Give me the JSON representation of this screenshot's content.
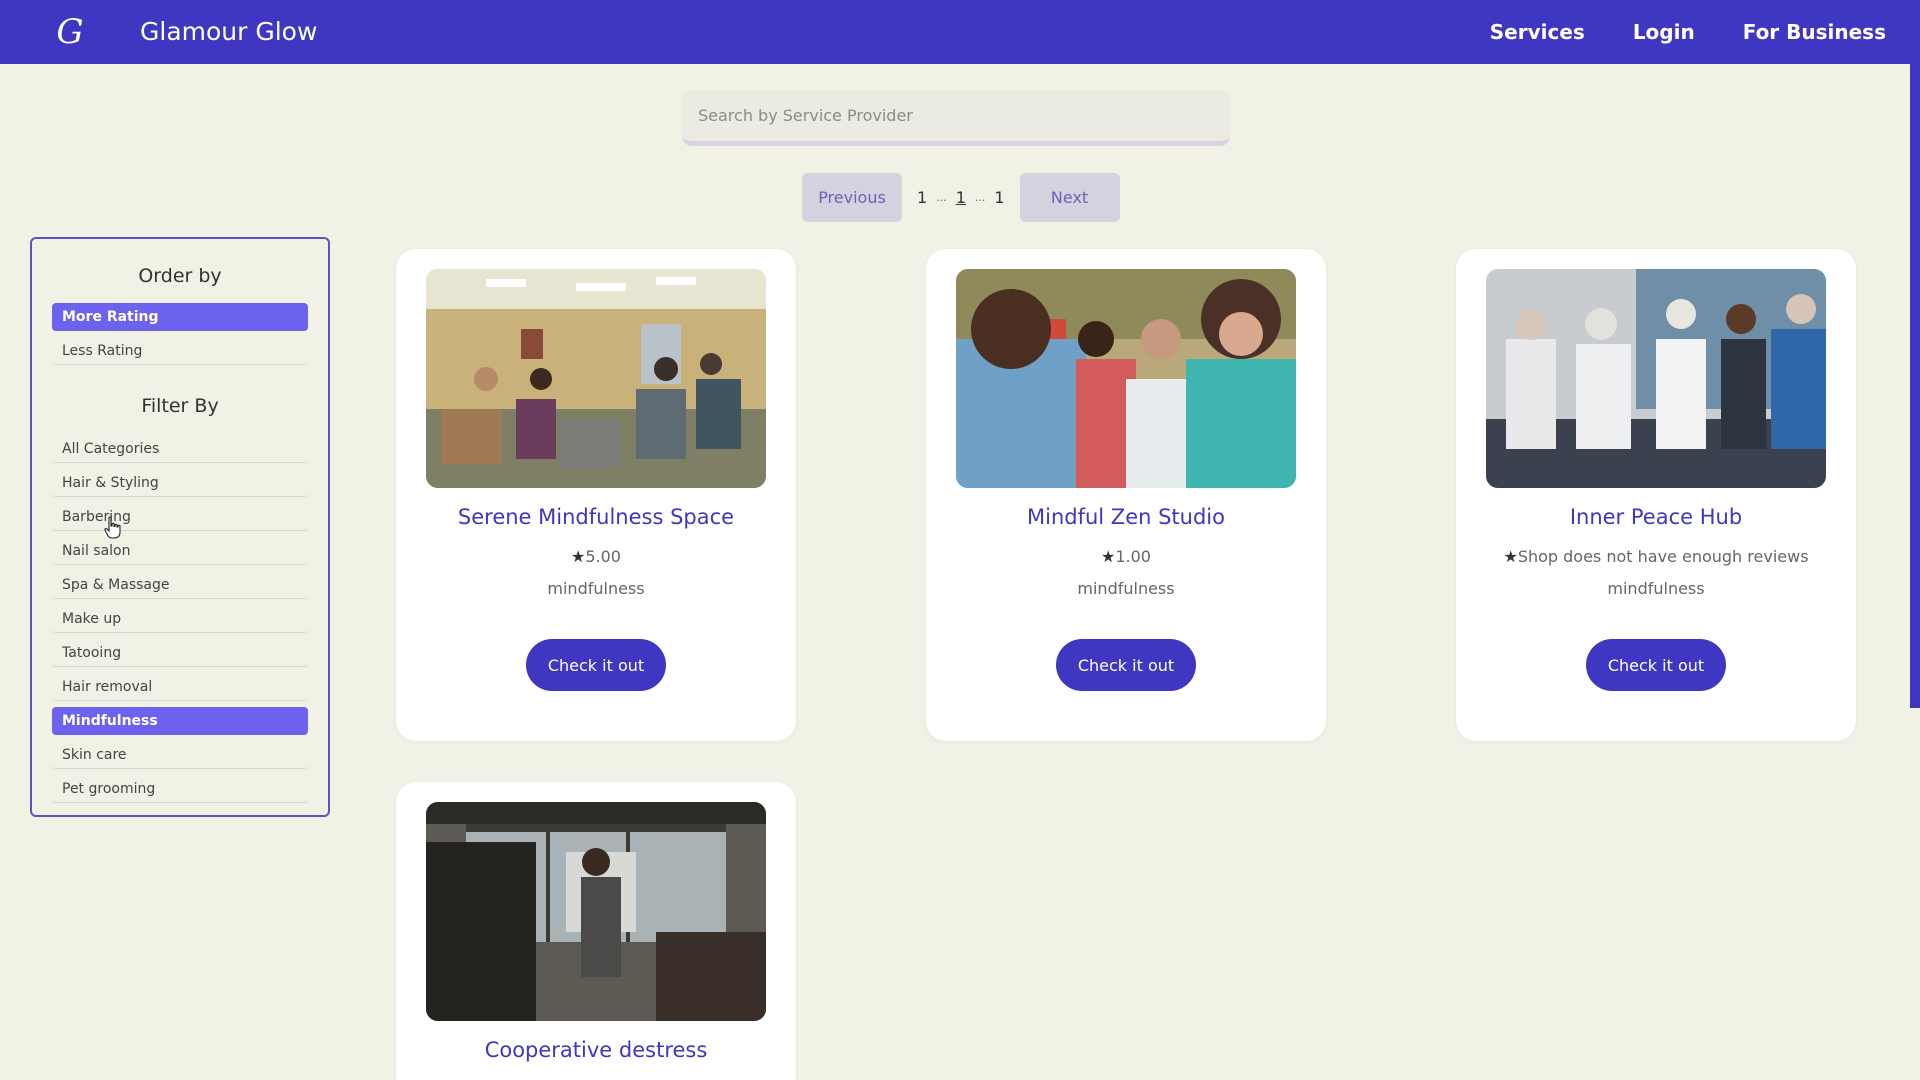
{
  "app": {
    "logo_glyph": "G",
    "brand": "Glamour Glow"
  },
  "nav": {
    "services": "Services",
    "login": "Login",
    "for_business": "For Business"
  },
  "search": {
    "placeholder": "Search by Service Provider"
  },
  "pagination": {
    "previous": "Previous",
    "next": "Next",
    "first": "1",
    "dots_left": "...",
    "current": "1",
    "dots_right": "...",
    "last": "1"
  },
  "sidebar": {
    "order_heading": "Order by",
    "order_options": [
      {
        "label": "More Rating",
        "active": true
      },
      {
        "label": "Less Rating",
        "active": false
      }
    ],
    "filter_heading": "Filter By",
    "filters": [
      {
        "label": "All Categories",
        "active": false
      },
      {
        "label": "Hair & Styling",
        "active": false
      },
      {
        "label": "Barbering",
        "active": false
      },
      {
        "label": "Nail salon",
        "active": false
      },
      {
        "label": "Spa & Massage",
        "active": false
      },
      {
        "label": "Make up",
        "active": false
      },
      {
        "label": "Tatooing",
        "active": false
      },
      {
        "label": "Hair removal",
        "active": false
      },
      {
        "label": "Mindfulness",
        "active": true
      },
      {
        "label": "Skin care",
        "active": false
      },
      {
        "label": "Pet grooming",
        "active": false
      }
    ]
  },
  "cards": [
    {
      "title": "Serene Mindfulness Space",
      "rating": "5.00",
      "category": "mindfulness",
      "button": "Check it out",
      "star": "★"
    },
    {
      "title": "Mindful Zen Studio",
      "rating": "1.00",
      "category": "mindfulness",
      "button": "Check it out",
      "star": "★"
    },
    {
      "title": "Inner Peace Hub",
      "rating": "Shop does not have enough reviews",
      "category": "mindfulness",
      "button": "Check it out",
      "star": "★"
    },
    {
      "title": "Cooperative destress",
      "rating": "",
      "category": "",
      "button": "",
      "star": ""
    }
  ],
  "colors": {
    "primary": "#3f36c2",
    "active_filter": "#6c62ee",
    "background": "#f1f1e6"
  }
}
